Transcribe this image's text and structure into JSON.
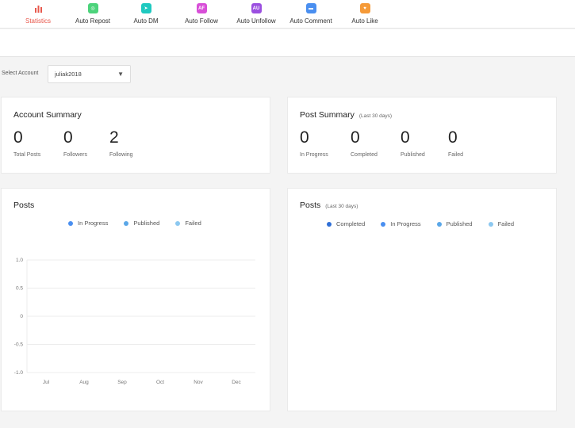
{
  "nav": {
    "items": [
      {
        "label": "Statistics",
        "icon": "bar-chart-icon",
        "glyph": "",
        "color": "#e8584c",
        "active": true
      },
      {
        "label": "Auto Repost",
        "icon": "repost-icon",
        "glyph": "◎",
        "color": "#4cd37b",
        "active": false
      },
      {
        "label": "Auto DM",
        "icon": "paper-plane-icon",
        "glyph": "➤",
        "color": "#1fc9c0",
        "active": false
      },
      {
        "label": "Auto Follow",
        "icon": "follow-icon",
        "glyph": "AF",
        "color": "#d84fd8",
        "active": false
      },
      {
        "label": "Auto Unfollow",
        "icon": "unfollow-icon",
        "glyph": "AU",
        "color": "#9b4fe0",
        "active": false
      },
      {
        "label": "Auto Comment",
        "icon": "comment-icon",
        "glyph": "▬",
        "color": "#4a8ff0",
        "active": false
      },
      {
        "label": "Auto Like",
        "icon": "heart-icon",
        "glyph": "♥",
        "color": "#f59a38",
        "active": false
      }
    ]
  },
  "account_select": {
    "label": "Select Account",
    "value": "juliak2018",
    "arrow": "▼"
  },
  "account_summary": {
    "title": "Account Summary",
    "stats": [
      {
        "value": "0",
        "label": "Total Posts"
      },
      {
        "value": "0",
        "label": "Followers"
      },
      {
        "value": "2",
        "label": "Following"
      }
    ]
  },
  "post_summary": {
    "title": "Post Summary",
    "subtitle": "(Last 30 days)",
    "stats": [
      {
        "value": "0",
        "label": "In Progress"
      },
      {
        "value": "0",
        "label": "Completed"
      },
      {
        "value": "0",
        "label": "Published"
      },
      {
        "value": "0",
        "label": "Failed"
      }
    ]
  },
  "posts_chart": {
    "title": "Posts",
    "legend": [
      {
        "label": "In Progress",
        "color": "#4a8ff0"
      },
      {
        "label": "Published",
        "color": "#5aa7e8"
      },
      {
        "label": "Failed",
        "color": "#8cc8f0"
      }
    ]
  },
  "posts_30": {
    "title": "Posts",
    "subtitle": "(Last 30 days)",
    "legend": [
      {
        "label": "Completed",
        "color": "#2f6fd6"
      },
      {
        "label": "In Progress",
        "color": "#4a8ff0"
      },
      {
        "label": "Published",
        "color": "#5aa7e8"
      },
      {
        "label": "Failed",
        "color": "#8cc8f0"
      }
    ]
  },
  "chart_data": {
    "type": "line",
    "categories": [
      "Jul",
      "Aug",
      "Sep",
      "Oct",
      "Nov",
      "Dec"
    ],
    "yticks": [
      "1.0",
      "0.5",
      "0",
      "-0.5",
      "-1.0"
    ],
    "ylim": [
      -1.0,
      1.0
    ],
    "grid": true,
    "legend_position": "top",
    "series": [
      {
        "name": "In Progress",
        "values": []
      },
      {
        "name": "Published",
        "values": []
      },
      {
        "name": "Failed",
        "values": []
      }
    ]
  }
}
